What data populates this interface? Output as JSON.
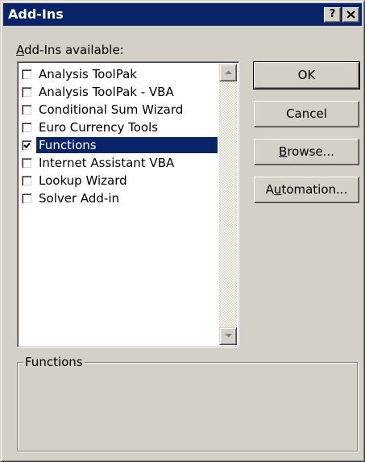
{
  "window": {
    "title": "Add-Ins",
    "help_label": "?",
    "close_label": "✕"
  },
  "addins_label": {
    "mnemonic": "A",
    "rest": "dd-Ins available:"
  },
  "addins": [
    {
      "label": "Analysis ToolPak",
      "checked": false,
      "selected": false
    },
    {
      "label": "Analysis ToolPak - VBA",
      "checked": false,
      "selected": false
    },
    {
      "label": "Conditional Sum Wizard",
      "checked": false,
      "selected": false
    },
    {
      "label": "Euro Currency Tools",
      "checked": false,
      "selected": false
    },
    {
      "label": "Functions",
      "checked": true,
      "selected": true
    },
    {
      "label": "Internet Assistant VBA",
      "checked": false,
      "selected": false
    },
    {
      "label": "Lookup Wizard",
      "checked": false,
      "selected": false
    },
    {
      "label": "Solver Add-in",
      "checked": false,
      "selected": false
    }
  ],
  "buttons": {
    "ok": "OK",
    "cancel": "Cancel",
    "browse": {
      "mnemonic": "B",
      "rest": "rowse..."
    },
    "automation": {
      "pre": "A",
      "mnemonic": "u",
      "rest": "tomation..."
    }
  },
  "description": {
    "group_label": "Functions",
    "text": ""
  },
  "colors": {
    "face": "#d4d0c8",
    "title_bar": "#0a246a",
    "selection": "#0a246a"
  }
}
